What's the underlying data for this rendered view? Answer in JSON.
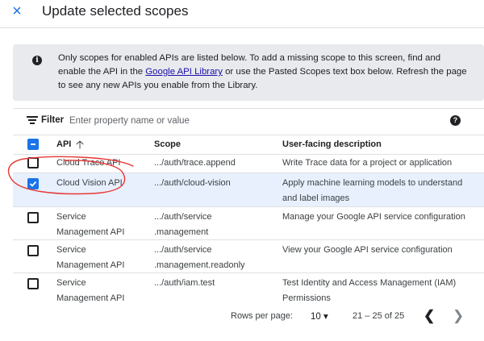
{
  "dialog": {
    "close_icon": "×",
    "title": "Update selected scopes"
  },
  "info": {
    "icon": "i",
    "text_before_link": "Only scopes for enabled APIs are listed below. To add a missing scope to this screen, find and enable the API in the ",
    "link": "Google API Library",
    "text_after_link": " or use the Pasted Scopes text box below. Refresh the page to see any new APIs you enable from the Library."
  },
  "filter": {
    "label": "Filter",
    "placeholder": "Enter property name or value",
    "help_icon": "?"
  },
  "table": {
    "columns": {
      "api": "API",
      "sort_arrow": "🡡",
      "scope": "Scope",
      "description": "User-facing description"
    },
    "rows": [
      {
        "api": "Cloud Trace API",
        "scope": ".../auth/trace.append",
        "description": "Write Trace data for a project or application",
        "checked": false
      },
      {
        "api": "Cloud Vision API",
        "scope": ".../auth/cloud-vision",
        "description": "Apply machine learning models to understand and label images",
        "checked": true
      },
      {
        "api": "Service Management API",
        "scope": ".../auth/service .management",
        "description": "Manage your Google API service configuration",
        "checked": false
      },
      {
        "api": "Service Management API",
        "scope": ".../auth/service .management.readonly",
        "description": "View your Google API service configuration",
        "checked": false
      },
      {
        "api": "Service Management API",
        "scope": ".../auth/iam.test",
        "description": "Test Identity and Access Management (IAM) Permissions",
        "checked": false
      }
    ]
  },
  "pagination": {
    "rows_per_page_label": "Rows per page:",
    "rows_per_page": "10 ▾",
    "range": "21 – 25 of 25",
    "prev": "❮",
    "next": "❯"
  },
  "colors": {
    "accent": "#1a73e8",
    "selected_row": "#e8f0fe",
    "info_bg": "#e8eaed",
    "annotation": "#e53935"
  }
}
